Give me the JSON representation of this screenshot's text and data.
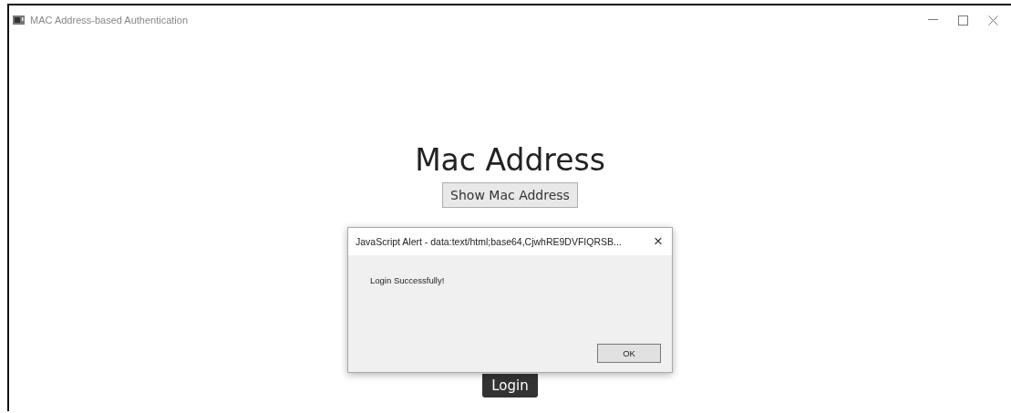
{
  "window": {
    "title": "MAC Address-based Authentication"
  },
  "page": {
    "heading": "Mac Address",
    "show_button": "Show Mac Address",
    "login_button": "Login"
  },
  "alert": {
    "title": "JavaScript Alert - data:text/html;base64,CjwhRE9DVFIQRSB...",
    "close": "×",
    "message": "Login Successfully!",
    "ok_button": "OK"
  }
}
